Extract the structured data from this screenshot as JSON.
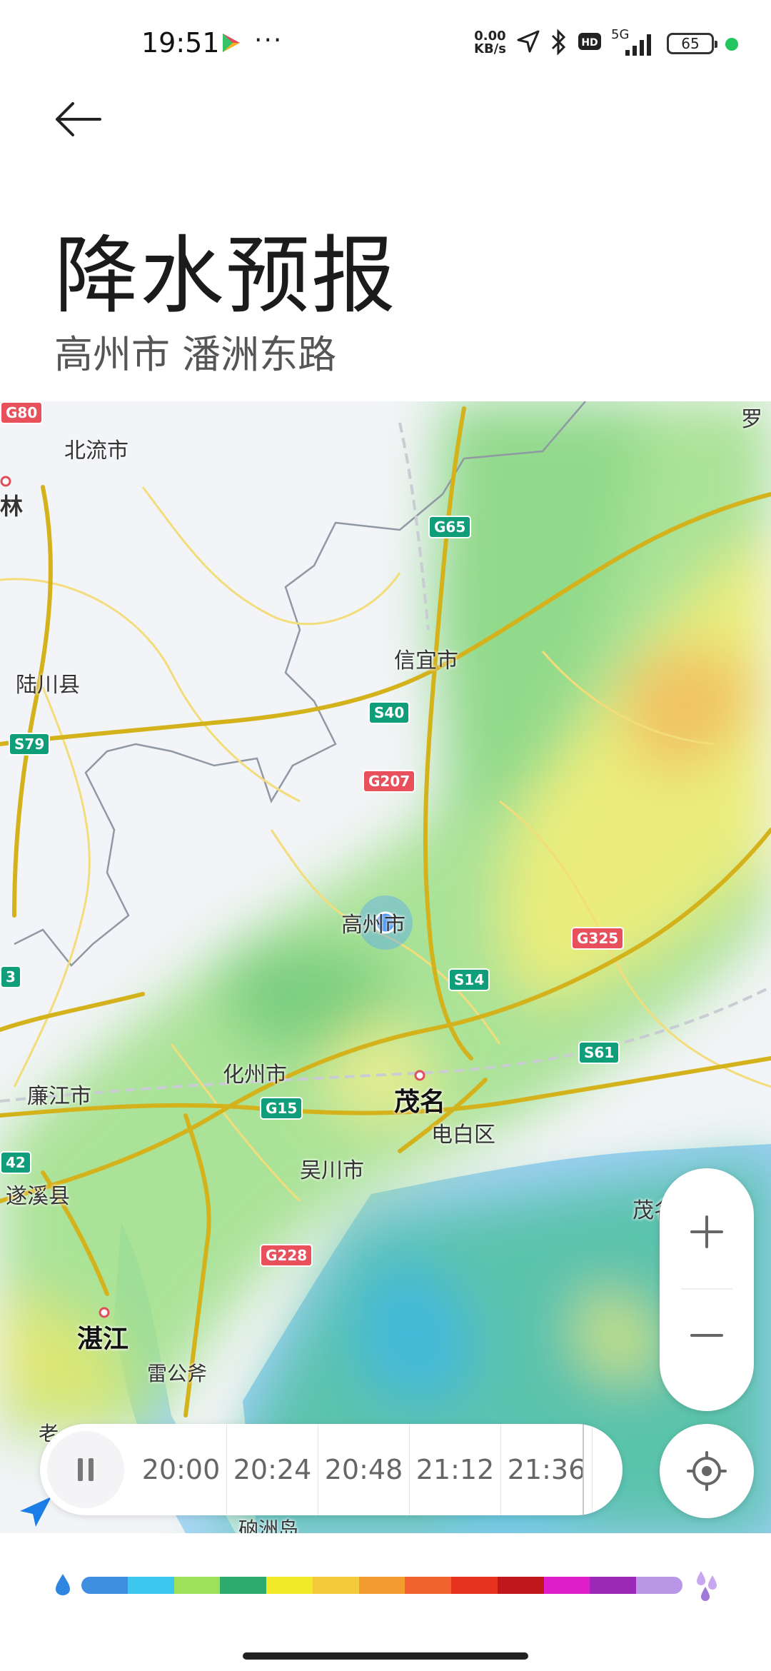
{
  "status_bar": {
    "time": "19:51",
    "net_speed_value": "0.00",
    "net_speed_unit": "KB/s",
    "network": "5G",
    "battery": "65",
    "icons": [
      "play-store-icon",
      "more-dots-icon",
      "location-arrow-icon",
      "bluetooth-icon",
      "hd-icon",
      "signal-icon",
      "battery-icon"
    ],
    "more": "···"
  },
  "header": {
    "title": "降水预报",
    "location": "高州市 潘洲东路"
  },
  "map": {
    "labels": {
      "beiliu": "北流市",
      "lin": "林",
      "luchuan": "陆川县",
      "xinyi": "信宜市",
      "gaozhou": "高州市",
      "huazhou": "化州市",
      "maoming": "茂名",
      "lianjiang": "廉江市",
      "dianbai": "电白区",
      "wuchuan": "吴川市",
      "suixi": "遂溪县",
      "zhanjiang": "湛江",
      "leigongfu": "雷公斧",
      "maogang": "茂名",
      "luo": "罗",
      "lao": "老",
      "naozhoudao": "硇洲岛"
    },
    "shields": {
      "g80": "G80",
      "g65": "G65",
      "s79": "S79",
      "s40": "S40",
      "g207": "G207",
      "g325": "G325",
      "s14": "S14",
      "s61": "S61",
      "g15": "G15",
      "g228": "G228",
      "n3": "3",
      "n42": "42"
    }
  },
  "controls": {
    "zoom_in": "+",
    "zoom_out": "−"
  },
  "timeline": {
    "times": [
      "20:00",
      "20:24",
      "20:48",
      "21:12",
      "21:36"
    ]
  },
  "legend": {
    "colors": [
      "#3f8fe0",
      "#3cc7ee",
      "#9fe05a",
      "#2eaa6e",
      "#f0ea2a",
      "#f5c93c",
      "#f29b2f",
      "#f0612e",
      "#e5331f",
      "#c0171a",
      "#e01ec9",
      "#9b29b5",
      "#b996e6"
    ]
  }
}
